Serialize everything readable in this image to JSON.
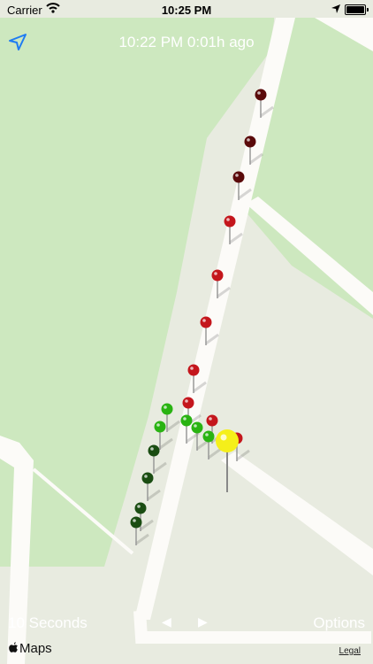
{
  "status_bar": {
    "carrier": "Carrier",
    "time": "10:25 PM"
  },
  "header": {
    "time_text": "10:22 PM 0:01h ago"
  },
  "controls": {
    "interval_label": "10 Seconds",
    "prev_label": "◀",
    "next_label": "▶",
    "options_label": "Options"
  },
  "footer": {
    "maps_label": "Maps",
    "legal_label": "Legal"
  },
  "colors": {
    "park": "#cde8bf",
    "ground": "#e8ebe0",
    "road": "#fcfbf8",
    "pin_dark_red": "#5a0a0a",
    "pin_red": "#c4161c",
    "pin_green": "#29b312",
    "pin_dark_green": "#1a4d12",
    "pin_current": "#f5ef1a",
    "accent_blue": "#1f7cf2"
  },
  "icons": {
    "wifi": "wifi-icon",
    "location": "location-arrow-icon",
    "battery": "battery-icon",
    "apple": "apple-logo-icon"
  },
  "pins": {
    "count": 21,
    "current": "yellow"
  }
}
